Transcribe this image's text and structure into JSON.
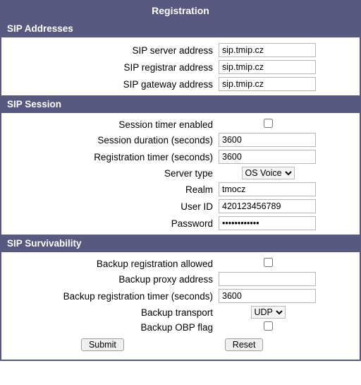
{
  "title": "Registration",
  "sections": {
    "addresses": {
      "header": "SIP Addresses",
      "sip_server_label": "SIP server address",
      "sip_server_value": "sip.tmip.cz",
      "sip_registrar_label": "SIP registrar address",
      "sip_registrar_value": "sip.tmip.cz",
      "sip_gateway_label": "SIP gateway address",
      "sip_gateway_value": "sip.tmip.cz"
    },
    "session": {
      "header": "SIP Session",
      "timer_enabled_label": "Session timer enabled",
      "timer_enabled_checked": false,
      "duration_label": "Session duration (seconds)",
      "duration_value": "3600",
      "reg_timer_label": "Registration timer (seconds)",
      "reg_timer_value": "3600",
      "server_type_label": "Server type",
      "server_type_value": "OS Voice",
      "realm_label": "Realm",
      "realm_value": "tmocz",
      "user_id_label": "User ID",
      "user_id_value": "420123456789",
      "password_label": "Password",
      "password_value": "••••••••••••"
    },
    "survivability": {
      "header": "SIP Survivability",
      "backup_allowed_label": "Backup registration allowed",
      "backup_allowed_checked": false,
      "backup_proxy_label": "Backup proxy address",
      "backup_proxy_value": "",
      "backup_timer_label": "Backup registration timer (seconds)",
      "backup_timer_value": "3600",
      "backup_transport_label": "Backup transport",
      "backup_transport_value": "UDP",
      "backup_obp_label": "Backup OBP flag",
      "backup_obp_checked": false
    }
  },
  "buttons": {
    "submit": "Submit",
    "reset": "Reset"
  }
}
